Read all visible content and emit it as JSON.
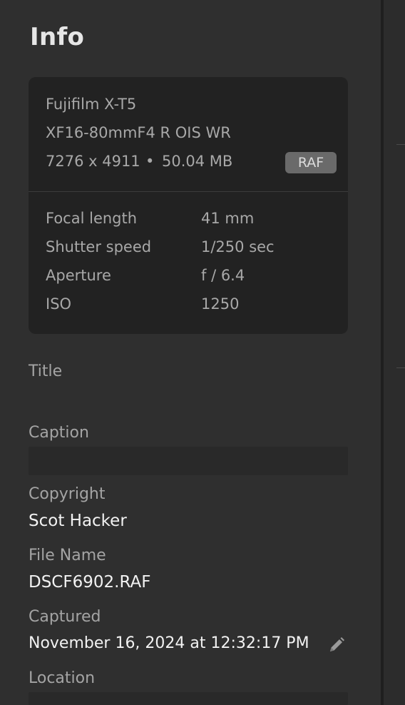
{
  "panel": {
    "title": "Info"
  },
  "camera": {
    "model": "Fujifilm X-T5",
    "lens": "XF16-80mmF4 R OIS WR",
    "dimensions": "7276 x 4911",
    "separator": "•",
    "file_size": "50.04 MB",
    "format_badge": "RAF"
  },
  "exif": {
    "rows": [
      {
        "label": "Focal length",
        "value": "41 mm"
      },
      {
        "label": "Shutter speed",
        "value": "1/250 sec"
      },
      {
        "label": "Aperture",
        "value": "f / 6.4"
      },
      {
        "label": "ISO",
        "value": "1250"
      }
    ]
  },
  "fields": {
    "title_label": "Title",
    "caption_label": "Caption",
    "caption_value": "",
    "copyright_label": "Copyright",
    "copyright_value": "Scot Hacker",
    "filename_label": "File Name",
    "filename_value": "DSCF6902.RAF",
    "captured_label": "Captured",
    "captured_value": "November 16, 2024 at 12:32:17 PM",
    "location_label": "Location",
    "location_value": ""
  },
  "icons": {
    "edit": "pencil-icon"
  },
  "colors": {
    "background": "#2f2f2f",
    "card": "#222222",
    "badge": "#6a6a6a"
  }
}
